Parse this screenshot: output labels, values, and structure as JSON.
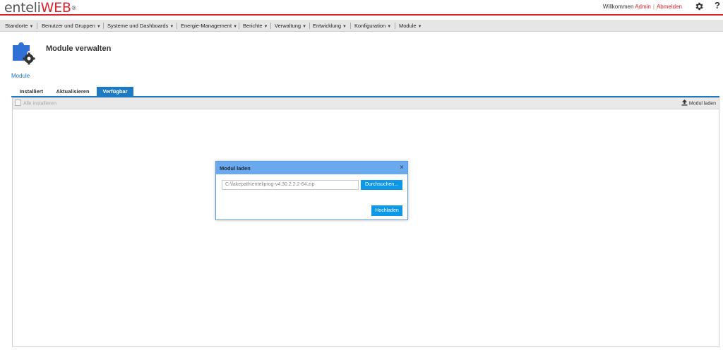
{
  "header": {
    "logo_part1": "enteli",
    "logo_part2": "WEB",
    "logo_reg": "®",
    "welcome_text": "Willkommen",
    "user_name": "Admin",
    "separator": "|",
    "logout_label": "Abmelden",
    "help_label": "?",
    "brand_color": "#d9232e"
  },
  "menu": {
    "items": [
      "Standorte",
      "Benutzer und Gruppen",
      "Systeme und Dashboards",
      "Energie-Management",
      "Berichte",
      "Verwaltung",
      "Entwicklung",
      "Konfiguration",
      "Module"
    ],
    "caret": "▼"
  },
  "page": {
    "title": "Module verwalten",
    "breadcrumb": "Module",
    "icon": "puzzle-gear-icon"
  },
  "tabs": [
    {
      "label": "Installiert",
      "active": false
    },
    {
      "label": "Aktualisieren",
      "active": false
    },
    {
      "label": "Verfügbar",
      "active": true
    }
  ],
  "toolbar": {
    "install_all_label": "Alle installieren",
    "load_module_label": "Modul laden"
  },
  "dialog": {
    "title": "Modul laden",
    "close": "×",
    "file_value": "C:\\fakepath\\enteliprog-v4.30.2.2.2-64.zip",
    "browse_label": "Durchsuchen...",
    "upload_label": "Hochladen"
  },
  "accent_color": "#1e7ac2"
}
